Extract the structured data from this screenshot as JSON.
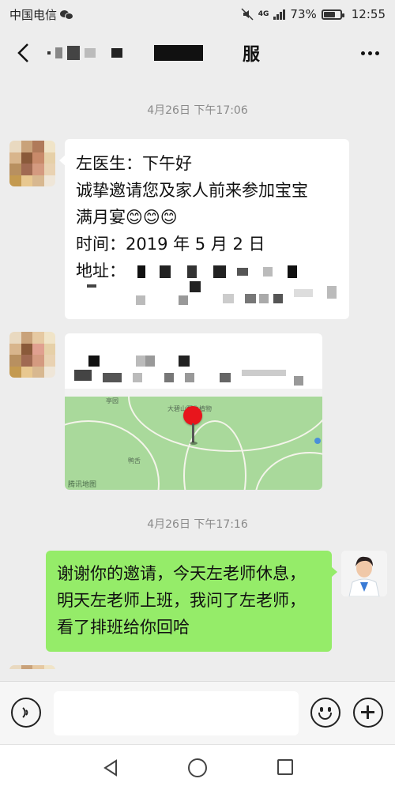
{
  "status_bar": {
    "carrier": "中国电信",
    "network": "4G",
    "battery_percent": "73%",
    "battery_level": 0.73,
    "time": "12:55",
    "icons": [
      "wechat-icon",
      "mute-icon",
      "signal-icon",
      "battery-icon"
    ]
  },
  "header": {
    "title_visible": "服",
    "back_icon": "chevron-left-icon",
    "more_icon": "more-dots-icon"
  },
  "messages": {
    "timestamp_1": "4月26日 下午17:06",
    "invite": {
      "line1": "左医生：下午好",
      "line2": "诚挚邀请您及家人前来参加宝宝",
      "line3": "满月宴",
      "emojis": "😊😊😊",
      "line4": "时间：2019 年 5 月 2 日",
      "address_label": "地址："
    },
    "location": {
      "map_brand": "腾讯地图",
      "map_label_1": "大碧山野生植物",
      "map_label_2": "鸭舌",
      "map_label_3": "亭园"
    },
    "timestamp_2": "4月26日 下午17:16",
    "reply": {
      "line1": "谢谢你的邀请，今天左老师休息，",
      "line2": "明天左老师上班，我问了左老师，",
      "line3": "看了排班给你回哈"
    }
  },
  "input_bar": {
    "placeholder": "",
    "voice_icon": "voice-icon",
    "emoji_icon": "emoji-icon",
    "plus_icon": "plus-icon"
  },
  "nav_bar": {
    "icons": [
      "back-triangle-icon",
      "home-circle-icon",
      "recent-square-icon"
    ]
  },
  "colors": {
    "background": "#ededed",
    "incoming_bubble": "#ffffff",
    "outgoing_bubble": "#95ec69",
    "map_green": "#a9d99b",
    "pin_red": "#e8151c"
  }
}
